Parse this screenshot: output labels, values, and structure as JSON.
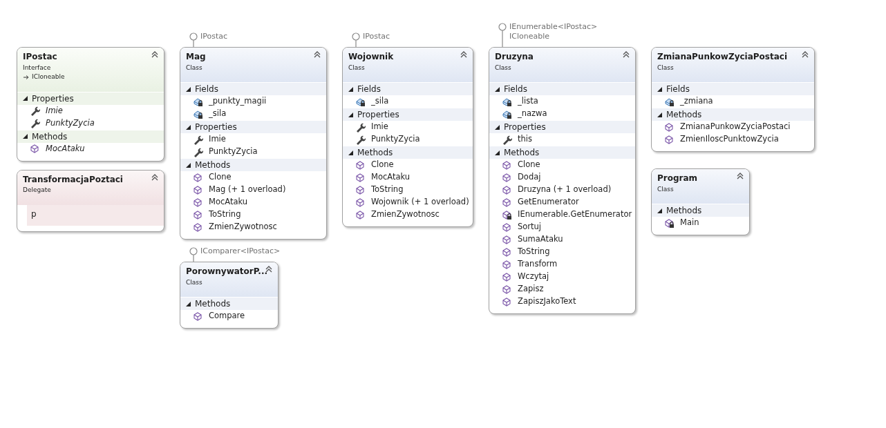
{
  "columns": [
    {
      "shapes": [
        {
          "name": "IPostac",
          "kind": "interface",
          "stereotype": "Interface",
          "inherits": "ICloneable",
          "sections": [
            {
              "title": "Properties",
              "expanded": true,
              "members": [
                {
                  "name": "Imie",
                  "kind": "property",
                  "private": false,
                  "abstract": true
                },
                {
                  "name": "PunktyZycia",
                  "kind": "property",
                  "private": false,
                  "abstract": true
                }
              ]
            },
            {
              "title": "Methods",
              "expanded": true,
              "members": [
                {
                  "name": "MocAtaku",
                  "kind": "method",
                  "private": false,
                  "abstract": true
                }
              ]
            }
          ]
        },
        {
          "name": "TransformacjaPoztaci",
          "kind": "delegate",
          "stereotype": "Delegate",
          "parameters": [
            "p"
          ]
        }
      ]
    },
    {
      "shapes": [
        {
          "name": "Mag",
          "kind": "class",
          "stereotype": "Class",
          "lollipop": [
            "IPostac"
          ],
          "sections": [
            {
              "title": "Fields",
              "expanded": true,
              "members": [
                {
                  "name": "_punkty_magii",
                  "kind": "field",
                  "private": true,
                  "abstract": false
                },
                {
                  "name": "_sila",
                  "kind": "field",
                  "private": true,
                  "abstract": false
                }
              ]
            },
            {
              "title": "Properties",
              "expanded": true,
              "members": [
                {
                  "name": "Imie",
                  "kind": "property",
                  "private": false,
                  "abstract": false
                },
                {
                  "name": "PunktyZycia",
                  "kind": "property",
                  "private": false,
                  "abstract": false
                }
              ]
            },
            {
              "title": "Methods",
              "expanded": true,
              "members": [
                {
                  "name": "Clone",
                  "kind": "method",
                  "private": false,
                  "abstract": false
                },
                {
                  "name": "Mag (+ 1 overload)",
                  "kind": "method",
                  "private": false,
                  "abstract": false
                },
                {
                  "name": "MocAtaku",
                  "kind": "method",
                  "private": false,
                  "abstract": false
                },
                {
                  "name": "ToString",
                  "kind": "method",
                  "private": false,
                  "abstract": false
                },
                {
                  "name": "ZmienZywotnosc",
                  "kind": "method",
                  "private": false,
                  "abstract": false
                }
              ]
            }
          ]
        },
        {
          "name": "PorownywatorP...",
          "kind": "class",
          "stereotype": "Class",
          "lollipop": [
            "IComparer<IPostac>"
          ],
          "sections": [
            {
              "title": "Methods",
              "expanded": true,
              "members": [
                {
                  "name": "Compare",
                  "kind": "method",
                  "private": false,
                  "abstract": false
                }
              ]
            }
          ]
        }
      ]
    },
    {
      "shapes": [
        {
          "name": "Wojownik",
          "kind": "class",
          "stereotype": "Class",
          "lollipop": [
            "IPostac"
          ],
          "sections": [
            {
              "title": "Fields",
              "expanded": true,
              "members": [
                {
                  "name": "_sila",
                  "kind": "field",
                  "private": true,
                  "abstract": false
                }
              ]
            },
            {
              "title": "Properties",
              "expanded": true,
              "members": [
                {
                  "name": "Imie",
                  "kind": "property",
                  "private": false,
                  "abstract": false
                },
                {
                  "name": "PunktyZycia",
                  "kind": "property",
                  "private": false,
                  "abstract": false
                }
              ]
            },
            {
              "title": "Methods",
              "expanded": true,
              "members": [
                {
                  "name": "Clone",
                  "kind": "method",
                  "private": false,
                  "abstract": false
                },
                {
                  "name": "MocAtaku",
                  "kind": "method",
                  "private": false,
                  "abstract": false
                },
                {
                  "name": "ToString",
                  "kind": "method",
                  "private": false,
                  "abstract": false
                },
                {
                  "name": "Wojownik (+ 1 overload)",
                  "kind": "method",
                  "private": false,
                  "abstract": false
                },
                {
                  "name": "ZmienZywotnosc",
                  "kind": "method",
                  "private": false,
                  "abstract": false
                }
              ]
            }
          ]
        }
      ]
    },
    {
      "shapes": [
        {
          "name": "Druzyna",
          "kind": "class",
          "stereotype": "Class",
          "lollipop": [
            "IEnumerable<IPostac>",
            "ICloneable"
          ],
          "sections": [
            {
              "title": "Fields",
              "expanded": true,
              "members": [
                {
                  "name": "_lista",
                  "kind": "field",
                  "private": true,
                  "abstract": false
                },
                {
                  "name": "_nazwa",
                  "kind": "field",
                  "private": true,
                  "abstract": false
                }
              ]
            },
            {
              "title": "Properties",
              "expanded": true,
              "members": [
                {
                  "name": "this",
                  "kind": "property",
                  "private": false,
                  "abstract": false
                }
              ]
            },
            {
              "title": "Methods",
              "expanded": true,
              "members": [
                {
                  "name": "Clone",
                  "kind": "method",
                  "private": false,
                  "abstract": false
                },
                {
                  "name": "Dodaj",
                  "kind": "method",
                  "private": false,
                  "abstract": false
                },
                {
                  "name": "Druzyna (+ 1 overload)",
                  "kind": "method",
                  "private": false,
                  "abstract": false
                },
                {
                  "name": "GetEnumerator",
                  "kind": "method",
                  "private": false,
                  "abstract": false
                },
                {
                  "name": "IEnumerable.GetEnumerator",
                  "kind": "method",
                  "private": true,
                  "abstract": false
                },
                {
                  "name": "Sortuj",
                  "kind": "method",
                  "private": false,
                  "abstract": false
                },
                {
                  "name": "SumaAtaku",
                  "kind": "method",
                  "private": false,
                  "abstract": false
                },
                {
                  "name": "ToString",
                  "kind": "method",
                  "private": false,
                  "abstract": false
                },
                {
                  "name": "Transform",
                  "kind": "method",
                  "private": false,
                  "abstract": false
                },
                {
                  "name": "Wczytaj",
                  "kind": "method",
                  "private": false,
                  "abstract": false
                },
                {
                  "name": "Zapisz",
                  "kind": "method",
                  "private": false,
                  "abstract": false
                },
                {
                  "name": "ZapiszJakoText",
                  "kind": "method",
                  "private": false,
                  "abstract": false
                }
              ]
            }
          ]
        }
      ]
    },
    {
      "shapes": [
        {
          "name": "ZmianaPunkowZyciaPostaci",
          "kind": "class",
          "stereotype": "Class",
          "sections": [
            {
              "title": "Fields",
              "expanded": true,
              "members": [
                {
                  "name": "_zmiana",
                  "kind": "field",
                  "private": true,
                  "abstract": false
                }
              ]
            },
            {
              "title": "Methods",
              "expanded": true,
              "members": [
                {
                  "name": "ZmianaPunkowZyciaPostaci",
                  "kind": "method",
                  "private": false,
                  "abstract": false
                },
                {
                  "name": "ZmienIloscPunktowZycia",
                  "kind": "method",
                  "private": false,
                  "abstract": false
                }
              ]
            }
          ]
        },
        {
          "name": "Program",
          "kind": "class",
          "stereotype": "Class",
          "sections": [
            {
              "title": "Methods",
              "expanded": true,
              "members": [
                {
                  "name": "Main",
                  "kind": "method",
                  "private": true,
                  "abstract": false
                }
              ]
            }
          ]
        }
      ]
    }
  ]
}
